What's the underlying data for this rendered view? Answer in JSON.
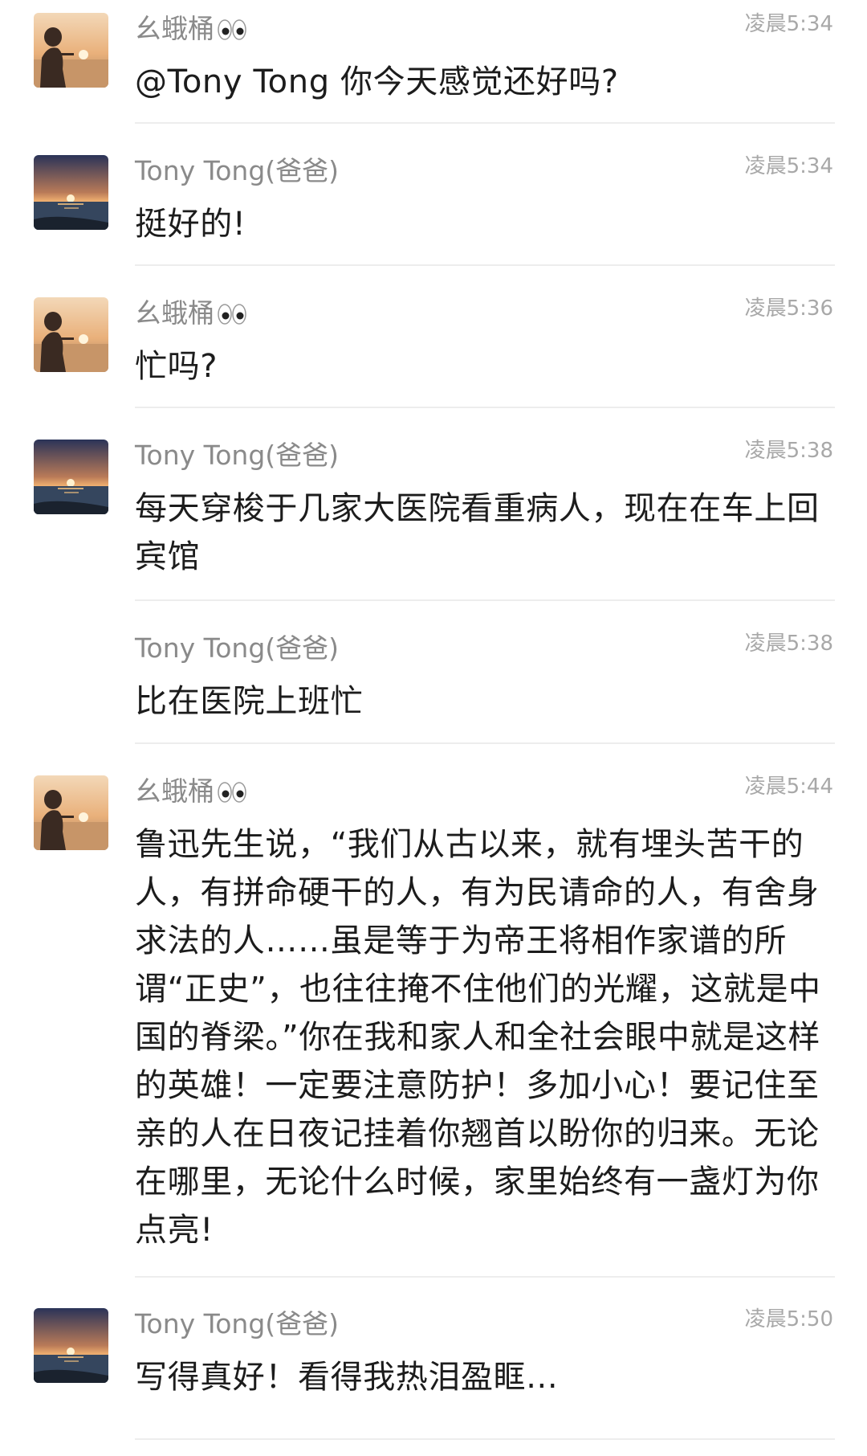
{
  "messages": [
    {
      "avatar": "silhouette-sunset",
      "sender": "幺蛾桶",
      "emoji": "eyes-emoji",
      "time": "凌晨5:34",
      "text": "@Tony Tong 你今天感觉还好吗?"
    },
    {
      "avatar": "sea-sunset",
      "sender": "Tony Tong(爸爸)",
      "time": "凌晨5:34",
      "text": "挺好的!"
    },
    {
      "avatar": "silhouette-sunset",
      "sender": "幺蛾桶",
      "emoji": "eyes-emoji",
      "time": "凌晨5:36",
      "text": "忙吗?"
    },
    {
      "avatar": "sea-sunset",
      "sender": "Tony Tong(爸爸)",
      "time": "凌晨5:38",
      "text": "每天穿梭于几家大医院看重病人，现在在车上回宾馆"
    },
    {
      "avatar": "none",
      "sender": "Tony Tong(爸爸)",
      "time": "凌晨5:38",
      "text": "比在医院上班忙"
    },
    {
      "avatar": "silhouette-sunset",
      "sender": "幺蛾桶",
      "emoji": "eyes-emoji",
      "time": "凌晨5:44",
      "text": "鲁迅先生说，“我们从古以来，就有埋头苦干的人，有拼命硬干的人，有为民请命的人，有舍身求法的人……虽是等于为帝王将相作家谱的所谓“正史”，也往往掩不住他们的光耀，这就是中国的脊梁。”你在我和家人和全社会眼中就是这样的英雄！一定要注意防护！多加小心！要记住至亲的人在日夜记挂着你翘首以盼你的归来。无论在哪里，无论什么时候，家里始终有一盏灯为你点亮!"
    },
    {
      "avatar": "sea-sunset",
      "sender": "Tony Tong(爸爸)",
      "time": "凌晨5:50",
      "text": "写得真好！看得我热泪盈眶..."
    }
  ]
}
